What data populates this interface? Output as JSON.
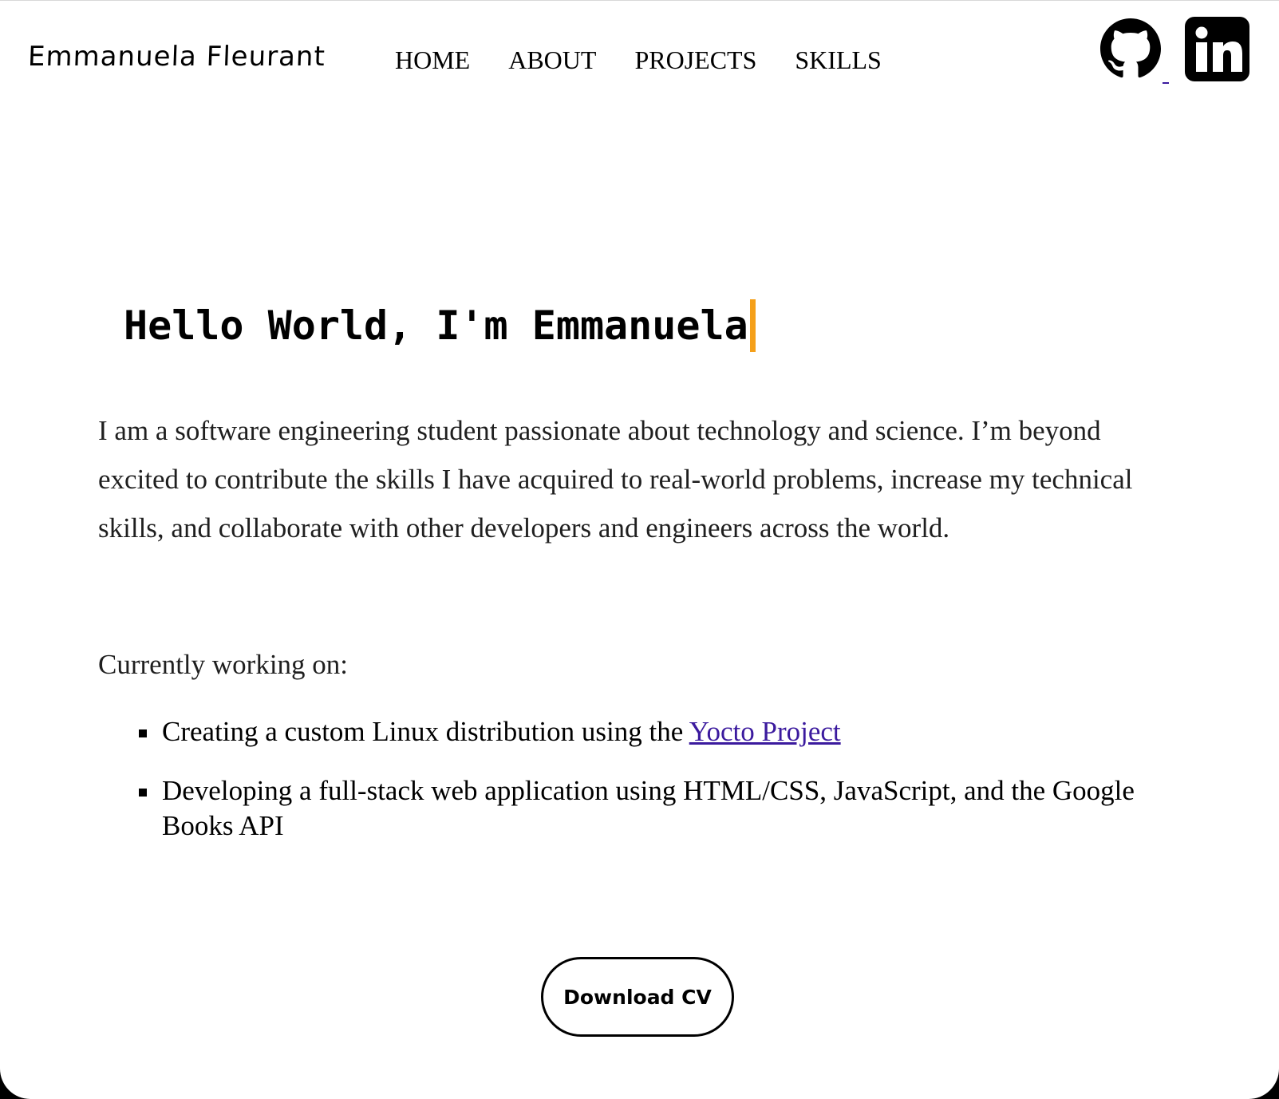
{
  "header": {
    "logo_text": "Emmanuela Fleurant",
    "nav": [
      {
        "label": "HOME"
      },
      {
        "label": "ABOUT"
      },
      {
        "label": "PROJECTS"
      },
      {
        "label": "SKILLS"
      }
    ],
    "social": [
      {
        "icon": "github-icon"
      },
      {
        "icon": "linkedin-icon"
      }
    ]
  },
  "hero": {
    "title": "Hello World, I'm Emmanuela",
    "cursor_color": "#f5a01a"
  },
  "about": {
    "intro": "I am a software engineering student passionate about technology and science. I’m beyond excited to contribute the skills I have acquired to real-world problems, increase my technical skills, and collaborate with other developers and engineers across the world.",
    "working_label": "Currently working on:",
    "items": [
      {
        "text_before": "Creating a custom Linux distribution using the ",
        "link_text": "Yocto Project"
      },
      {
        "text": "Developing a full-stack web application using HTML/CSS, JavaScript, and the Google Books API"
      }
    ]
  },
  "cta": {
    "download_label": "Download CV"
  },
  "colors": {
    "link": "#3b1a9e",
    "accent": "#f5a01a",
    "text": "#1f1f1f"
  }
}
